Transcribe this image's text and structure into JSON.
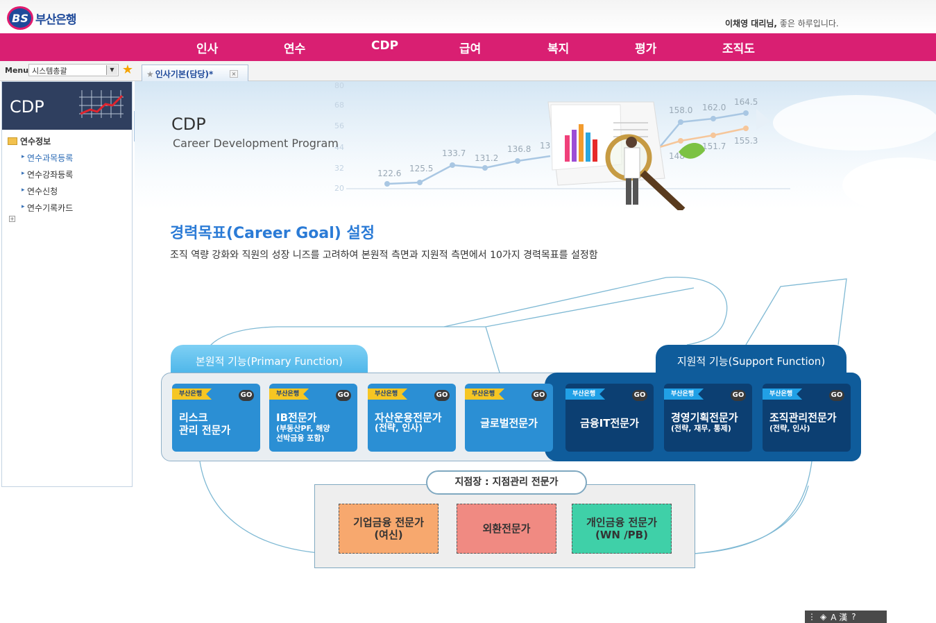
{
  "header": {
    "logo_mark": "BS",
    "logo_text": "부산은행",
    "user_name": "이채영 대리님,",
    "greeting": " 좋은 하루입니다."
  },
  "gnb": [
    "인사",
    "연수",
    "CDP",
    "급여",
    "복지",
    "평가",
    "조직도"
  ],
  "menu_bar": {
    "label": "Menu",
    "select_value": "시스템총괄",
    "tab_label": "인사기본(담당)*"
  },
  "sidebar": {
    "title": "CDP",
    "root": "연수정보",
    "items": [
      "연수과목등록",
      "연수강좌등록",
      "연수신청",
      "연수기록카드"
    ]
  },
  "banner": {
    "title": "CDP",
    "subtitle": "Career Development Program",
    "axis_labels": [
      "80",
      "68",
      "56",
      "44",
      "32",
      "20"
    ],
    "series_a": [
      "122.6",
      "125.5",
      "133.7",
      "131.2",
      "136.8",
      "13",
      "148",
      "158.0",
      "162.0",
      "164.5"
    ],
    "series_b": [
      "151.7",
      "155.3"
    ]
  },
  "content": {
    "title": "경력목표(Career Goal) 설정",
    "description": "조직 역량 강화와 직원의 성장 니즈를 고려하여 본원적 측면과 지원적 측면에서 10가지 경력목표를 설정함"
  },
  "functions": {
    "primary_label": "본원적 기능(Primary Function)",
    "support_label": "지원적 기능(Support Function)",
    "tag": "부산은행",
    "go": "GO",
    "cards": [
      {
        "title": "리스크\n관리 전문가",
        "sub": ""
      },
      {
        "title": "IB전문가",
        "sub": "(부동산PF, 해양\n선박금융 포함)"
      },
      {
        "title": "자산운용전문가",
        "sub": "(전략, 인사)"
      },
      {
        "title": "글로벌전문가",
        "sub": ""
      },
      {
        "title": "금융IT전문가",
        "sub": ""
      },
      {
        "title": "경영기획전문가",
        "sub": "(전략, 재무, 통제)"
      },
      {
        "title": "조직관리전문가",
        "sub": "(전략, 인사)"
      }
    ]
  },
  "branch": {
    "label": "지점장 : 지점관리 전문가",
    "cards": [
      {
        "title": "기업금융 전문가\n(여신)",
        "color": "#f7a86e"
      },
      {
        "title": "외환전문가",
        "color": "#f08a82"
      },
      {
        "title": "개인금융 전문가\n(WN /PB)",
        "color": "#3fd0a8"
      }
    ]
  },
  "footer_toolbar": {
    "hanja": "A 漢"
  }
}
